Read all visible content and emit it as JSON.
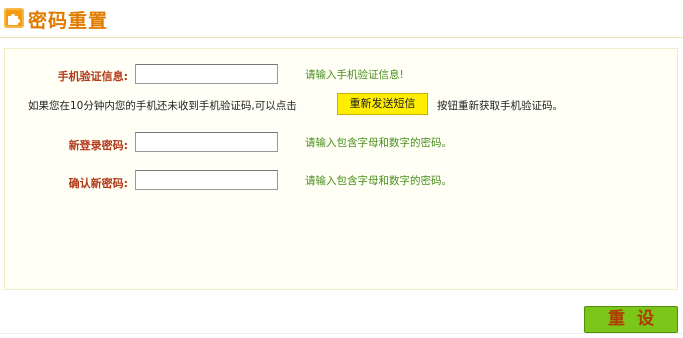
{
  "header": {
    "icon": "puzzle-icon",
    "title": "密码重置"
  },
  "form": {
    "verify": {
      "label": "手机验证信息:",
      "hint": "请输入手机验证信息!"
    },
    "resend": {
      "prefix": "如果您在10分钟内您的手机还未收到手机验证码,可以点击",
      "button": "重新发送短信",
      "suffix": "按钮重新获取手机验证码。"
    },
    "new_password": {
      "label": "新登录密码:",
      "hint": "请输入包含字母和数字的密码。"
    },
    "confirm_password": {
      "label": "确认新密码:",
      "hint": "请输入包含字母和数字的密码。"
    }
  },
  "actions": {
    "reset_label": "重设"
  },
  "colors": {
    "accent": "#e07b00",
    "label": "#b23a1a",
    "hint": "#4a8f1e",
    "button_yellow": "#ffee00",
    "button_green": "#7cc61a"
  }
}
